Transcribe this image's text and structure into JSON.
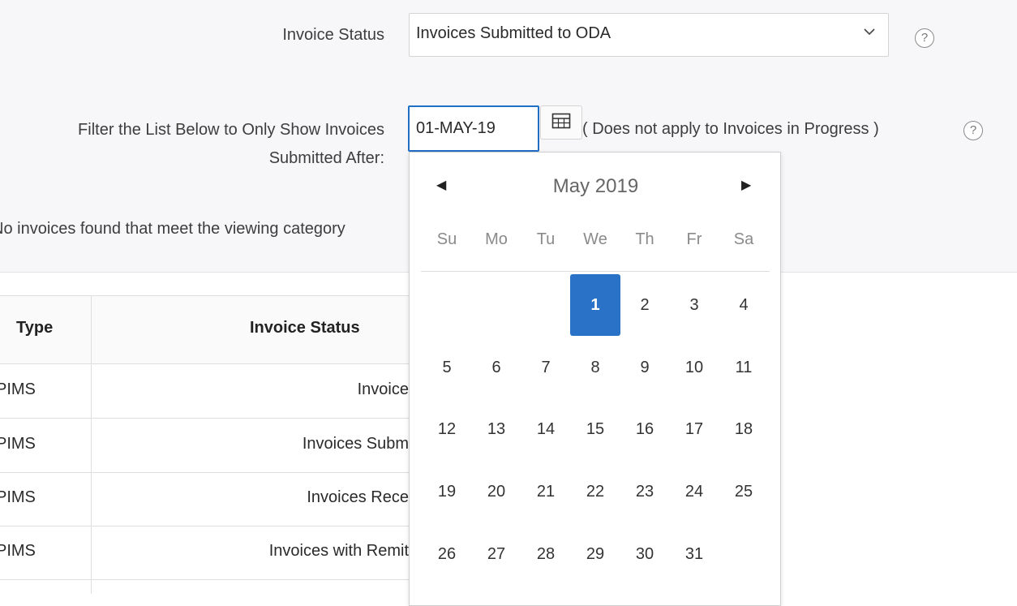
{
  "form": {
    "status_label": "Invoice Status",
    "status_value": "Invoices Submitted to ODA",
    "filter_label_line1": "Filter the List Below to Only Show Invoices",
    "filter_label_line2": "Submitted After:",
    "date_value": "01-MAY-19",
    "date_note": "( Does not apply to Invoices in Progress )",
    "help_glyph": "?"
  },
  "message": {
    "no_invoices": "No invoices found that meet the viewing category"
  },
  "table": {
    "headers": {
      "type": "Type",
      "status": "Invoice Status"
    },
    "rows": [
      {
        "type": "PIMS",
        "status": "Invoice"
      },
      {
        "type": "PIMS",
        "status": "Invoices Subm"
      },
      {
        "type": "PIMS",
        "status": "Invoices Rece"
      },
      {
        "type": "PIMS",
        "status": "Invoices with Remit"
      }
    ]
  },
  "calendar": {
    "month_label": "May 2019",
    "prev_icon": "◀",
    "next_icon": "▶",
    "weekdays": [
      "Su",
      "Mo",
      "Tu",
      "We",
      "Th",
      "Fr",
      "Sa"
    ],
    "selected_day": "1",
    "weeks": [
      [
        "",
        "",
        "",
        "1",
        "2",
        "3",
        "4"
      ],
      [
        "5",
        "6",
        "7",
        "8",
        "9",
        "10",
        "11"
      ],
      [
        "12",
        "13",
        "14",
        "15",
        "16",
        "17",
        "18"
      ],
      [
        "19",
        "20",
        "21",
        "22",
        "23",
        "24",
        "25"
      ],
      [
        "26",
        "27",
        "28",
        "29",
        "30",
        "31",
        ""
      ]
    ]
  },
  "colors": {
    "accent": "#2a72c8",
    "focus_border": "#1f6fc5",
    "panel_bg": "#f7f7f9"
  }
}
